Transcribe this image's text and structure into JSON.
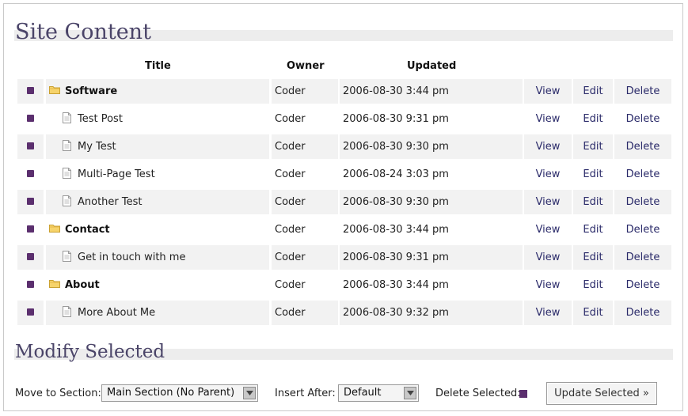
{
  "section_title": "Site Content",
  "columns": {
    "title": "Title",
    "owner": "Owner",
    "updated": "Updated"
  },
  "rows": [
    {
      "type": "folder",
      "title": "Software",
      "owner": "Coder",
      "updated": "2006-08-30 3:44 pm",
      "view": "View",
      "edit": "Edit",
      "delete": "Delete"
    },
    {
      "type": "page",
      "title": "Test Post",
      "owner": "Coder",
      "updated": "2006-08-30 9:31 pm",
      "view": "View",
      "edit": "Edit",
      "delete": "Delete"
    },
    {
      "type": "page",
      "title": "My Test",
      "owner": "Coder",
      "updated": "2006-08-30 9:30 pm",
      "view": "View",
      "edit": "Edit",
      "delete": "Delete"
    },
    {
      "type": "page",
      "title": "Multi-Page Test",
      "owner": "Coder",
      "updated": "2006-08-24 3:03 pm",
      "view": "View",
      "edit": "Edit",
      "delete": "Delete"
    },
    {
      "type": "page",
      "title": "Another Test",
      "owner": "Coder",
      "updated": "2006-08-30 9:30 pm",
      "view": "View",
      "edit": "Edit",
      "delete": "Delete"
    },
    {
      "type": "folder",
      "title": "Contact",
      "owner": "Coder",
      "updated": "2006-08-30 3:44 pm",
      "view": "View",
      "edit": "Edit",
      "delete": "Delete"
    },
    {
      "type": "page",
      "title": "Get in touch with me",
      "owner": "Coder",
      "updated": "2006-08-30 9:31 pm",
      "view": "View",
      "edit": "Edit",
      "delete": "Delete"
    },
    {
      "type": "folder",
      "title": "About",
      "owner": "Coder",
      "updated": "2006-08-30 3:44 pm",
      "view": "View",
      "edit": "Edit",
      "delete": "Delete"
    },
    {
      "type": "page",
      "title": "More About Me",
      "owner": "Coder",
      "updated": "2006-08-30 9:32 pm",
      "view": "View",
      "edit": "Edit",
      "delete": "Delete"
    }
  ],
  "modify": {
    "title": "Modify Selected",
    "move_label": "Move to Section:",
    "move_value": "Main Section (No Parent)",
    "insert_label": "Insert After:",
    "insert_value": "Default",
    "delete_label": "Delete Selected:",
    "update_button": "Update Selected »"
  },
  "colors": {
    "checkbox": "#5b2f6e",
    "link": "#2b2b6a",
    "heading": "#4a4468",
    "row_alt": "#f2f2f2"
  },
  "icons": {
    "folder": "folder-icon",
    "page": "page-icon",
    "dropdown": "chevron-down-icon"
  }
}
